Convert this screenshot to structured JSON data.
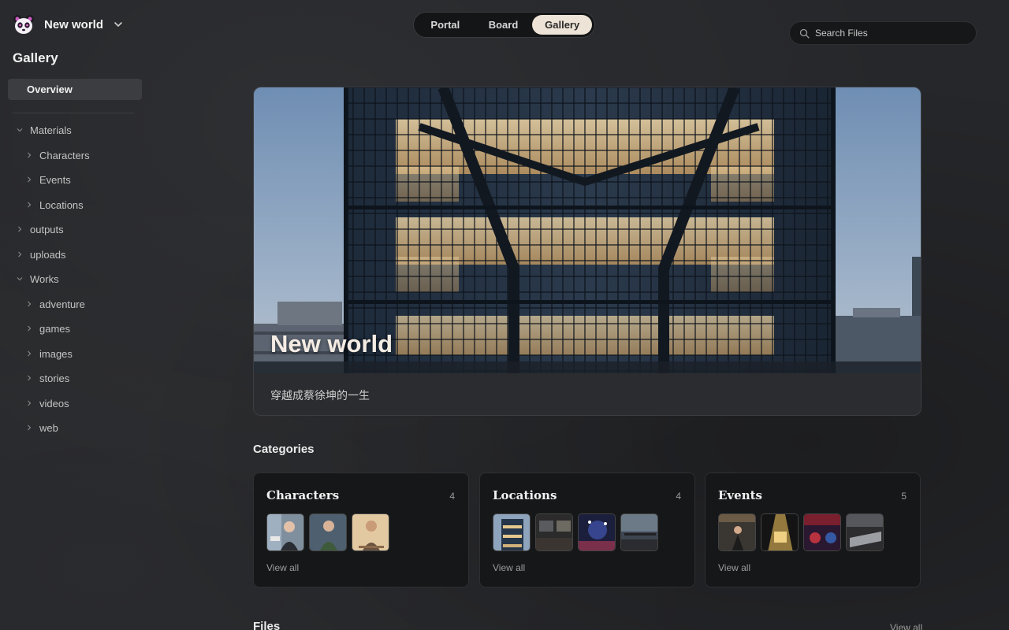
{
  "workspace": {
    "name": "New world"
  },
  "sidebar": {
    "title": "Gallery",
    "overview_label": "Overview",
    "tree": {
      "materials": "Materials",
      "characters": "Characters",
      "events": "Events",
      "locations": "Locations",
      "outputs": "outputs",
      "uploads": "uploads",
      "works": "Works",
      "adventure": "adventure",
      "games": "games",
      "images": "images",
      "stories": "stories",
      "videos": "videos",
      "web": "web"
    }
  },
  "nav": {
    "portal": "Portal",
    "board": "Board",
    "gallery": "Gallery",
    "active": "Gallery"
  },
  "search": {
    "placeholder": "Search Files"
  },
  "hero": {
    "title": "New world",
    "description": "穿越成蔡徐坤的一生"
  },
  "categories": {
    "title": "Categories",
    "view_all": "View all",
    "items": [
      {
        "name": "Characters",
        "count": "4"
      },
      {
        "name": "Locations",
        "count": "4"
      },
      {
        "name": "Events",
        "count": "5"
      }
    ]
  },
  "files": {
    "title": "Files",
    "view_all": "View all"
  },
  "colors": {
    "accent": "#ede3d6",
    "background": "#26272a",
    "card": "#161718"
  }
}
